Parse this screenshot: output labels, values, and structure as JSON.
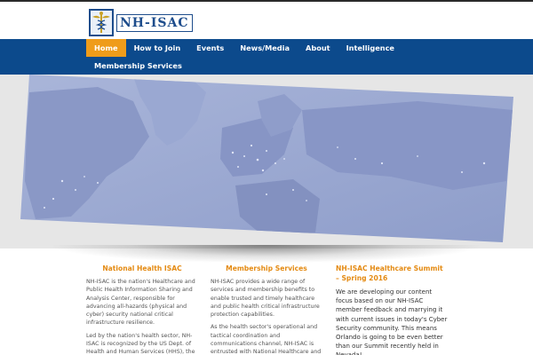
{
  "brand": {
    "logo_text": "NH-ISAC",
    "logo_icon": "caduceus-icon",
    "colors": {
      "nav": "#0c4a8c",
      "accent": "#ef9c1a",
      "heading": "#e48a12"
    }
  },
  "nav": {
    "items": [
      "Home",
      "How to Join",
      "Events",
      "News/Media",
      "About",
      "Intelligence"
    ],
    "second_row": "Membership Services",
    "active": "Home"
  },
  "hero": {
    "image": "world-map-at-night"
  },
  "columns": [
    {
      "title": "National Health ISAC",
      "paragraphs": [
        "NH-ISAC is the nation's Healthcare and Public Health Information Sharing and Analysis Center, responsible for advancing all-hazards (physical and cyber) security national critical infrastructure resilience.",
        "Led by the nation's health sector, NH-ISAC is recognized by the US Dept. of Health and Human Services (HHS), the"
      ]
    },
    {
      "title": "Membership Services",
      "paragraphs": [
        "NH-ISAC provides a wide range of services and membership benefits to enable trusted and timely healthcare and public health critical infrastructure protection capabilities.",
        "As the health sector's operational and tactical coordination and communications channel, NH-ISAC is entrusted with National Healthcare and"
      ]
    },
    {
      "title": "NH-ISAC Healthcare Summit – Spring 2016",
      "paragraphs": [
        "We are developing our content focus based on our NH-ISAC member feedback and marrying it with current issues in today's Cyber Security community. This means Orlando is going to be even better than our Summit recently held in Nevada!"
      ]
    }
  ]
}
